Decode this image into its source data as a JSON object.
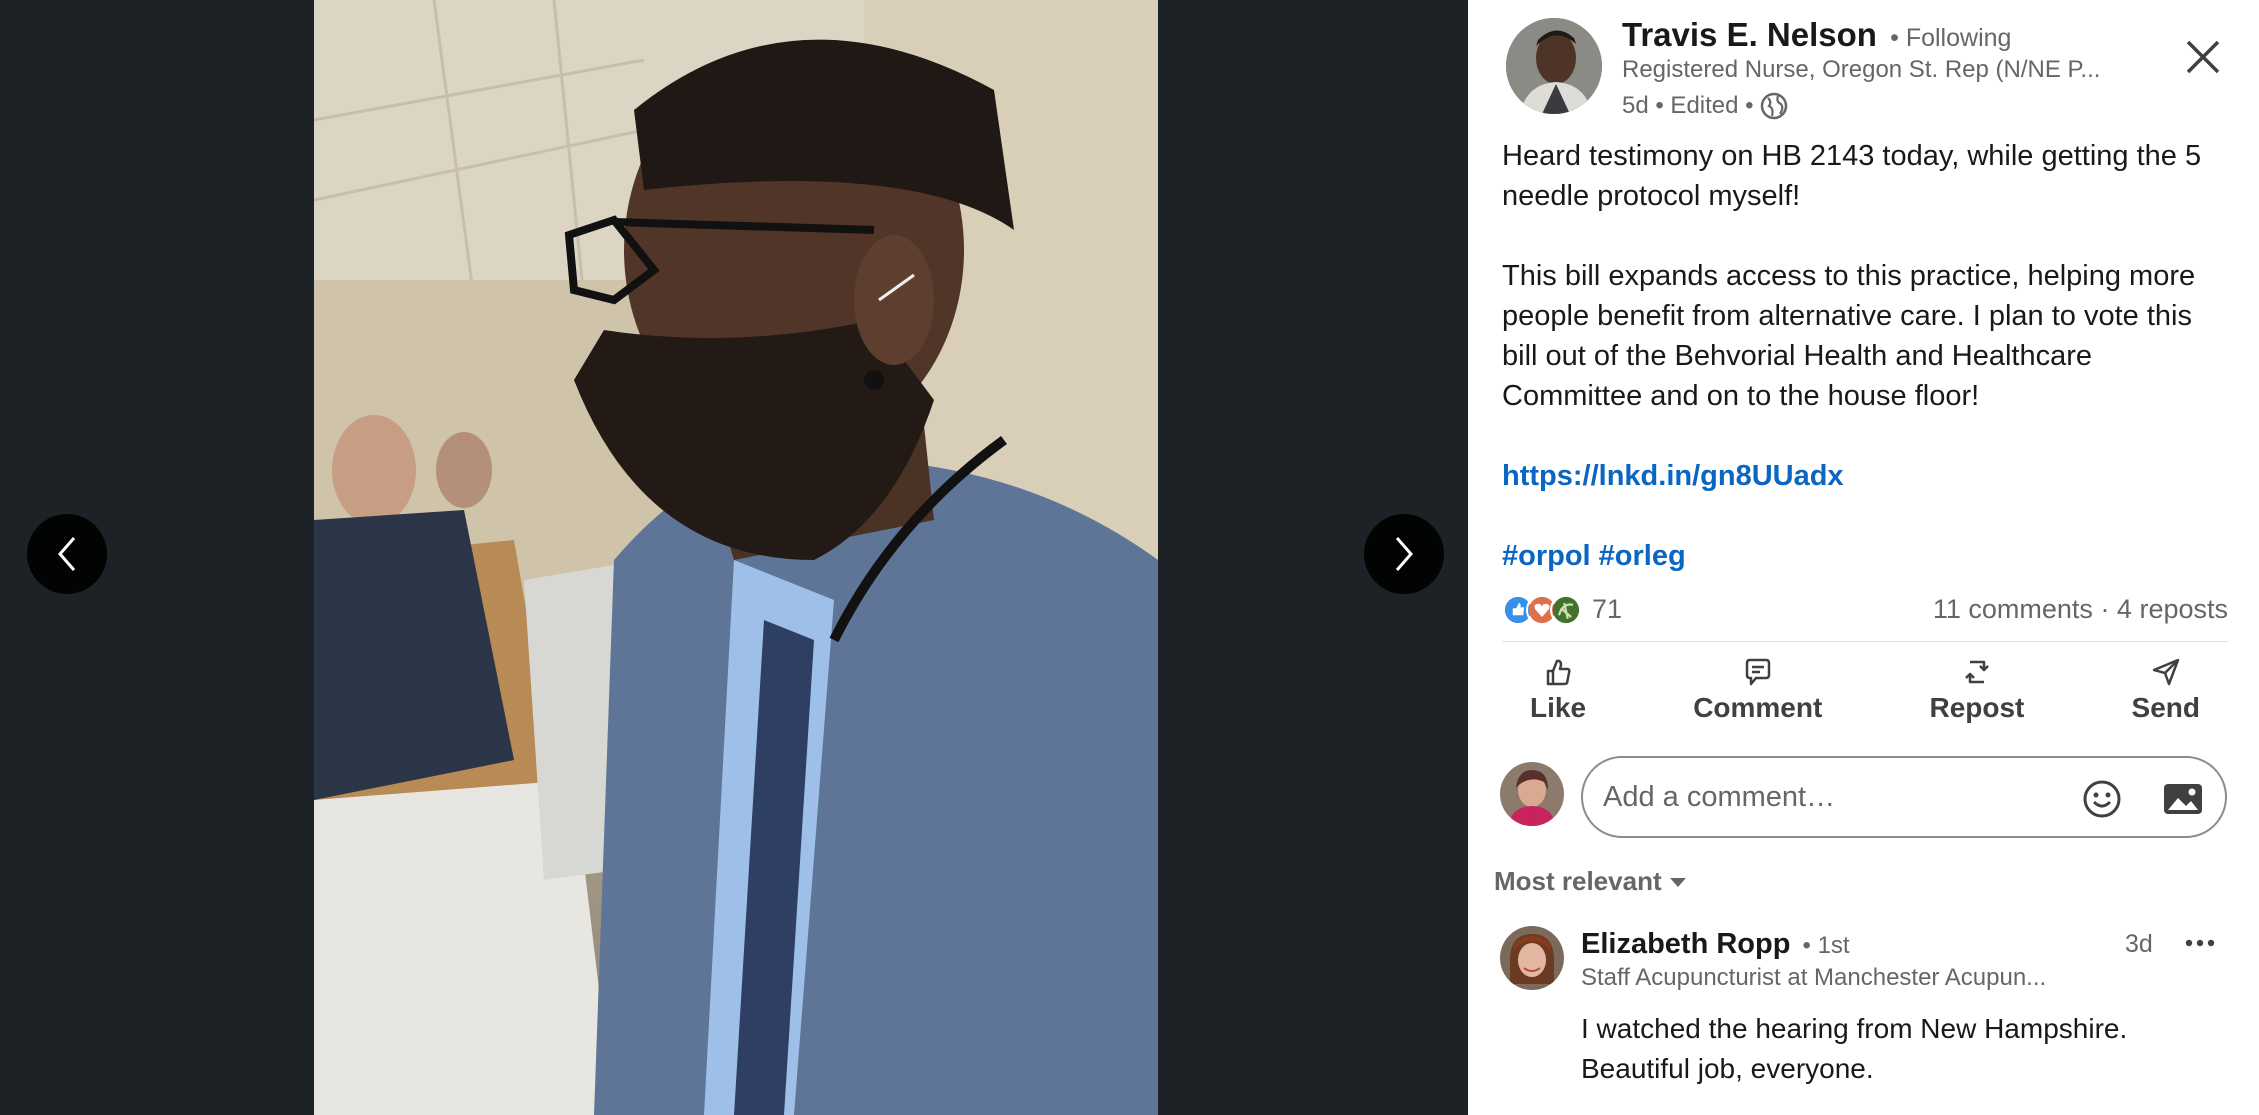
{
  "viewer": {
    "prev_icon": "chevron-left-icon",
    "next_icon": "chevron-right-icon"
  },
  "post": {
    "author": {
      "name": "Travis E. Nelson",
      "following": "• Following",
      "headline": "Registered Nurse, Oregon St. Rep (N/NE P...",
      "meta": "5d • Edited •"
    },
    "paragraphs": [
      "Heard testimony on HB 2143 today, while getting the 5 needle protocol myself!",
      "This bill expands access to this practice, helping more people benefit from alternative care. I plan to vote this bill out of the Behvorial Health and Healthcare Committee and on to the house floor!"
    ],
    "link": "https://lnkd.in/gn8UUadx",
    "hashtags": "#orpol #orleg"
  },
  "social": {
    "reaction_count": "71",
    "comments_reposts": "11 comments · 4 reposts"
  },
  "actions": {
    "like": "Like",
    "comment": "Comment",
    "repost": "Repost",
    "send": "Send"
  },
  "comment_box": {
    "placeholder": "Add a comment…"
  },
  "sort": {
    "label": "Most relevant"
  },
  "comment": {
    "name": "Elizabeth Ropp",
    "degree": "• 1st",
    "headline": "Staff Acupuncturist at Manchester Acupun...",
    "time": "3d",
    "text": "I watched the hearing from New Hampshire. Beautiful job, everyone."
  },
  "colors": {
    "link": "#0a66c2",
    "viewer_bg": "#1d2226"
  }
}
